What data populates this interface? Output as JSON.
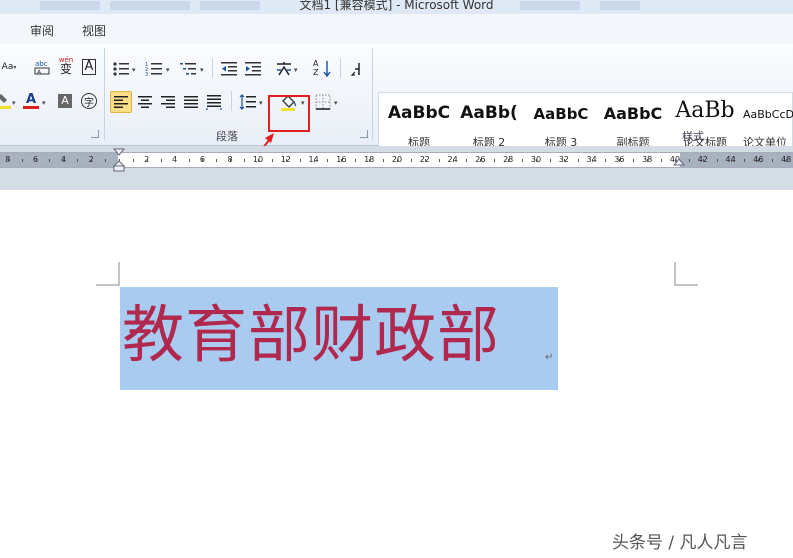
{
  "window": {
    "title": "文档1 [兼容模式] - Microsoft Word"
  },
  "menu": {
    "tabs": [
      "审阅",
      "视图"
    ]
  },
  "ribbon": {
    "groups": {
      "paragraph_label": "段落",
      "styles_label": "样式"
    },
    "font_buttons": {
      "change_case": "Aa",
      "phonetic_guide": "wén",
      "phonetic_char": "变",
      "char_border": "A",
      "font_color": "A",
      "char_shading": "A",
      "enclose_char": "字",
      "pinyin": "abc"
    },
    "paragraph": {
      "sort_top": "A",
      "sort_bottom": "Z",
      "font_color_accent": "#d91c1c",
      "highlight_color": "#f0e030"
    },
    "styles": [
      {
        "sample": "AaBbC",
        "name": "标题"
      },
      {
        "sample": "AaBb(",
        "name": "标题 2"
      },
      {
        "sample": "AaBbC",
        "name": "标题 3"
      },
      {
        "sample": "AaBbC",
        "name": "副标题"
      },
      {
        "sample": "AaBb",
        "name": "论文标题"
      },
      {
        "sample": "AaBbCcD",
        "name": "论文单位"
      }
    ]
  },
  "ruler": {
    "labels_left": [
      "8",
      "6",
      "4",
      "2"
    ],
    "labels_right": [
      "2",
      "4",
      "6",
      "8",
      "10",
      "12",
      "14",
      "16",
      "18",
      "20",
      "22",
      "24",
      "26",
      "28",
      "30",
      "32",
      "34",
      "36",
      "38",
      "40",
      "42",
      "44",
      "46",
      "48"
    ]
  },
  "document": {
    "text": "教育部财政部",
    "text_color": "#b0284e",
    "selection_color": "#a9cbf0",
    "paragraph_mark": "↵"
  },
  "watermark": "头条号 / 凡人凡言"
}
